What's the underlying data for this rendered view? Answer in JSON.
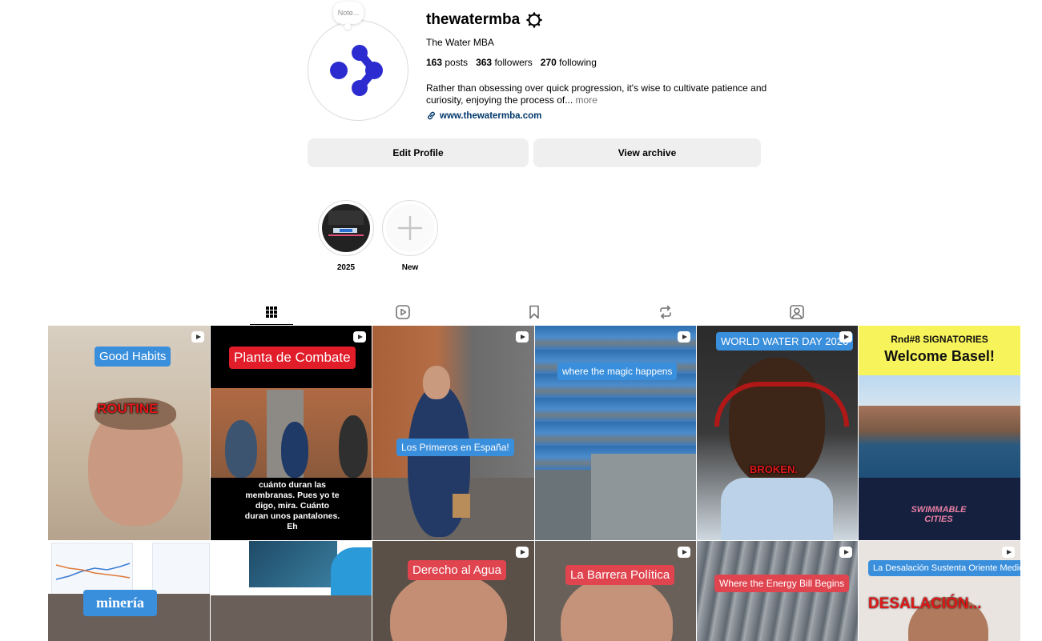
{
  "profile": {
    "note": "Note...",
    "username": "thewatermba",
    "full_name": "The Water MBA",
    "stats": {
      "posts_count": "163",
      "posts_label": "posts",
      "followers_count": "363",
      "followers_label": "followers",
      "following_count": "270",
      "following_label": "following"
    },
    "bio": "Rather than obsessing over quick progression, it's wise to cultivate patience and curiosity, enjoying the process of...",
    "bio_more": "more",
    "website": "www.thewatermba.com",
    "brand_color": "#2b2bd0"
  },
  "actions": {
    "edit_profile": "Edit Profile",
    "view_archive": "View archive"
  },
  "highlights": [
    {
      "label": "2025"
    },
    {
      "label": "New"
    }
  ],
  "tabs": [
    {
      "icon": "grid-icon",
      "active": true
    },
    {
      "icon": "reels-icon",
      "active": false
    },
    {
      "icon": "saved-icon",
      "active": false
    },
    {
      "icon": "reposts-icon",
      "active": false
    },
    {
      "icon": "tagged-icon",
      "active": false
    }
  ],
  "posts": [
    {
      "type": "reel",
      "captions": [
        "Good Habits",
        "ROUTINE"
      ]
    },
    {
      "type": "reel",
      "captions": [
        "Planta de Combate",
        "cuánto duran las membranas. Pues yo te digo, mira. Cuánto duran unos pantalones. Eh"
      ]
    },
    {
      "type": "reel",
      "captions": [
        "Los Primeros en España!"
      ]
    },
    {
      "type": "reel",
      "captions": [
        "where the magic happens"
      ]
    },
    {
      "type": "reel",
      "captions": [
        "WORLD WATER DAY 2026",
        "BROKEN."
      ]
    },
    {
      "type": "post",
      "captions": [
        "Rnd#8 SIGNATORIES",
        "Welcome Basel!",
        "SWIMMABLE CITIES"
      ]
    },
    {
      "type": "post",
      "captions": [
        "minería"
      ]
    },
    {
      "type": "post",
      "captions": []
    },
    {
      "type": "reel",
      "captions": [
        "Derecho al Agua"
      ]
    },
    {
      "type": "reel",
      "captions": [
        "La Barrera Política"
      ]
    },
    {
      "type": "reel",
      "captions": [
        "Where the Energy Bill Begins"
      ]
    },
    {
      "type": "reel",
      "captions": [
        "La Desalación Sustenta Oriente Medio",
        "DESALACIÓN..."
      ]
    }
  ]
}
